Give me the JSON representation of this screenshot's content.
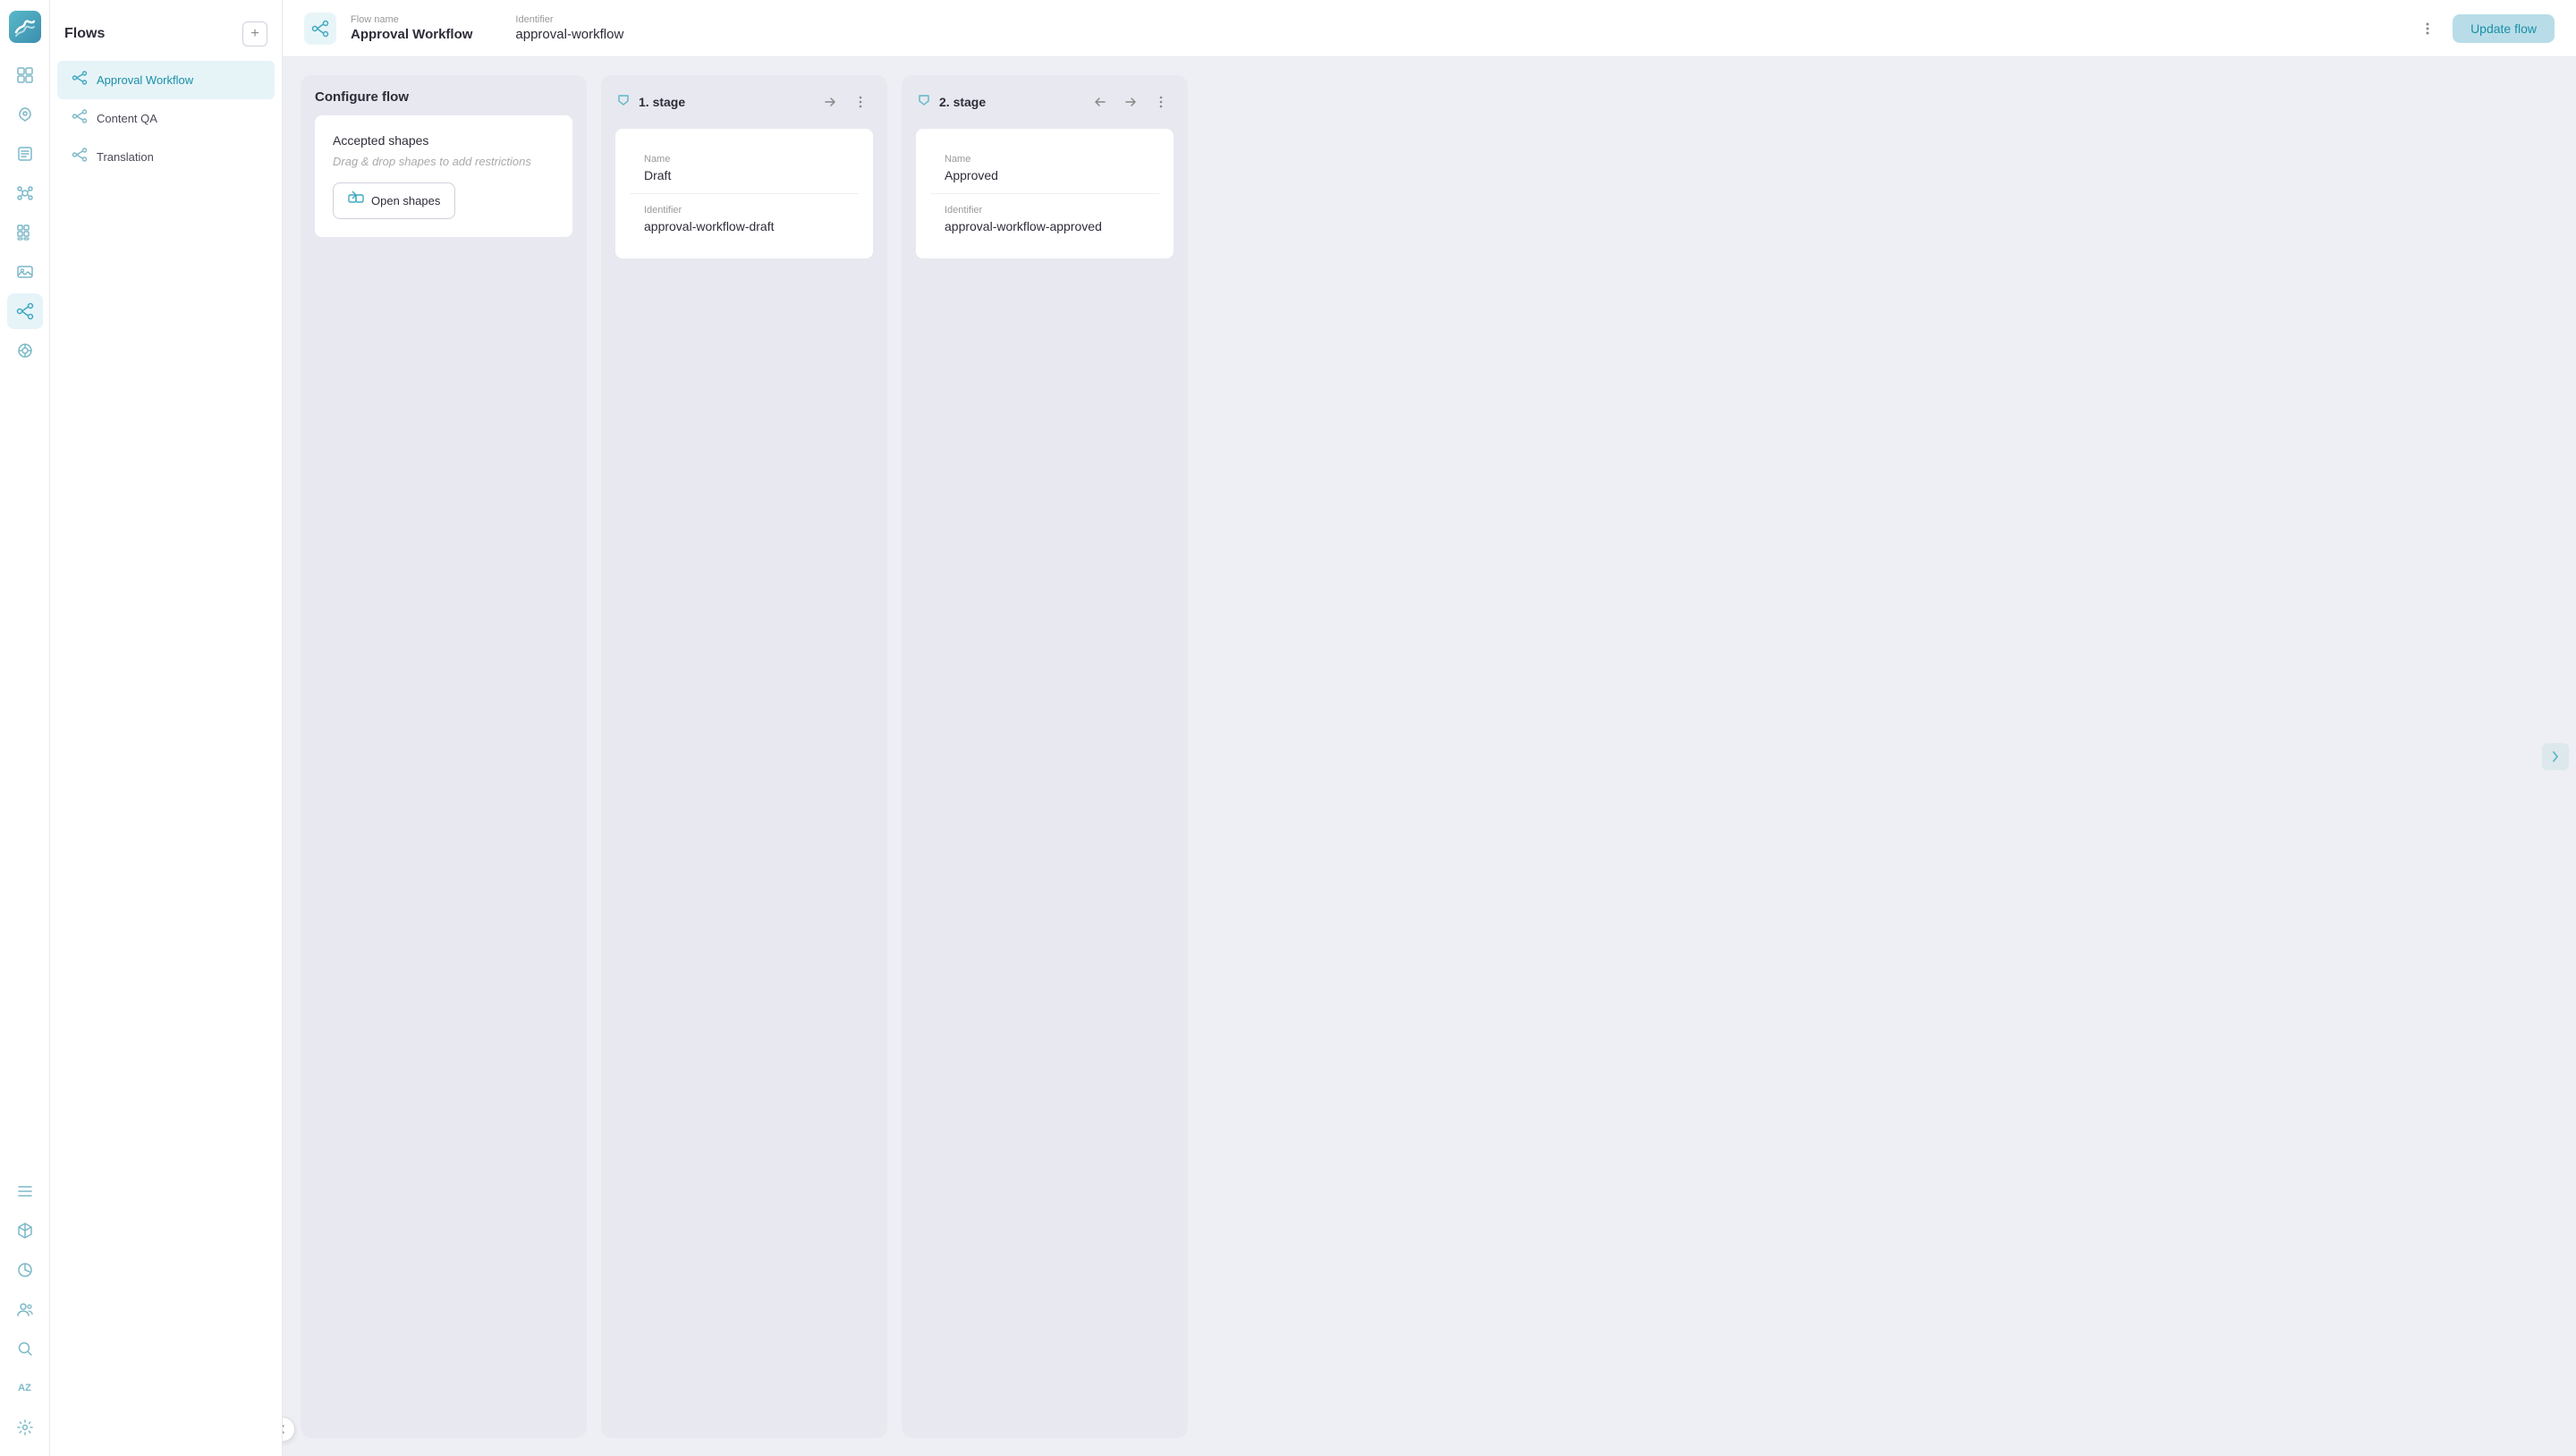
{
  "app": {
    "logo_text": "🌊"
  },
  "sidebar": {
    "title": "Flows",
    "add_button_label": "+",
    "items": [
      {
        "id": "approval-workflow",
        "label": "Approval Workflow",
        "active": true
      },
      {
        "id": "content-qa",
        "label": "Content QA",
        "active": false
      },
      {
        "id": "translation",
        "label": "Translation",
        "active": false
      }
    ]
  },
  "nav_icons": [
    {
      "name": "home-icon",
      "symbol": "⊞",
      "active": false
    },
    {
      "name": "rocket-icon",
      "symbol": "🚀",
      "active": false,
      "unicode": "✦"
    },
    {
      "name": "content-icon",
      "symbol": "☰",
      "active": false
    },
    {
      "name": "network-icon",
      "symbol": "⬡",
      "active": false
    },
    {
      "name": "grid-icon",
      "symbol": "⊞",
      "active": false
    },
    {
      "name": "image-icon",
      "symbol": "▦",
      "active": false
    },
    {
      "name": "flows-icon",
      "symbol": "⟳",
      "active": true
    },
    {
      "name": "settings2-icon",
      "symbol": "✿",
      "active": false
    },
    {
      "name": "list-icon",
      "symbol": "≡",
      "active": false
    },
    {
      "name": "box-icon",
      "symbol": "⬚",
      "active": false
    },
    {
      "name": "analytics-icon",
      "symbol": "◎",
      "active": false
    },
    {
      "name": "users-icon",
      "symbol": "👥",
      "active": false
    },
    {
      "name": "search-icon",
      "symbol": "🔍",
      "active": false
    },
    {
      "name": "az-icon",
      "symbol": "AZ",
      "active": false
    },
    {
      "name": "settings-icon",
      "symbol": "⚙",
      "active": false
    }
  ],
  "topbar": {
    "flow_name_label": "Flow name",
    "flow_name_value": "Approval Workflow",
    "identifier_label": "Identifier",
    "identifier_value": "approval-workflow",
    "update_button_label": "Update flow"
  },
  "configure_panel": {
    "title": "Configure flow",
    "accepted_shapes_title": "Accepted shapes",
    "accepted_shapes_hint": "Drag & drop shapes to add restrictions",
    "open_shapes_button": "Open shapes"
  },
  "stage1": {
    "title": "1. stage",
    "name_label": "Name",
    "name_value": "Draft",
    "identifier_label": "Identifier",
    "identifier_value": "approval-workflow-draft"
  },
  "stage2": {
    "title": "2. stage",
    "name_label": "Name",
    "name_value": "Approved",
    "identifier_label": "Identifier",
    "identifier_value": "approval-workflow-approved"
  },
  "colors": {
    "accent": "#3fa8c0",
    "light_accent": "#b8dde8",
    "sidebar_bg": "#ffffff",
    "content_bg": "#eeeef5"
  }
}
